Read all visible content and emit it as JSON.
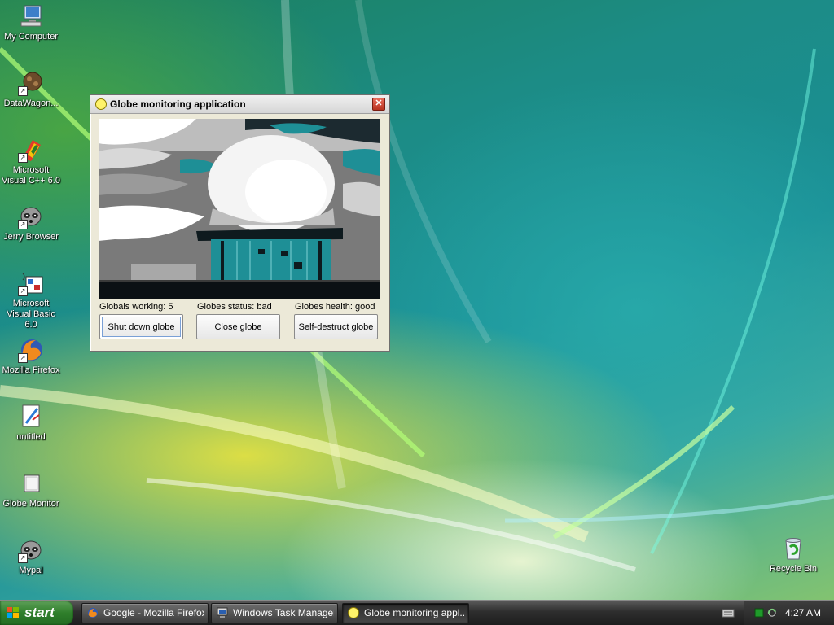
{
  "desktop": {
    "icons": [
      {
        "label": "My Computer",
        "icon": "computer-icon"
      },
      {
        "label": "DataWagon...",
        "icon": "datawagon-shortcut-icon"
      },
      {
        "label": "Microsoft Visual C++ 6.0",
        "icon": "visual-cpp-shortcut-icon"
      },
      {
        "label": "Jerry Browser",
        "icon": "raccoon-shortcut-icon"
      },
      {
        "label": "Microsoft Visual Basic 6.0",
        "icon": "visual-basic-shortcut-icon"
      },
      {
        "label": "Mozilla Firefox",
        "icon": "firefox-shortcut-icon"
      },
      {
        "label": "untitled",
        "icon": "paint-document-icon"
      },
      {
        "label": "Globe Monitor",
        "icon": "folder-icon"
      },
      {
        "label": "Mypal",
        "icon": "raccoon-shortcut-icon"
      }
    ],
    "recycle_bin": {
      "label": "Recycle Bin",
      "icon": "recycle-bin-icon"
    }
  },
  "window": {
    "title": "Globe monitoring application",
    "icon": "yellow-circle-icon",
    "close_glyph": "✕",
    "status": {
      "working": "Globals working: 5",
      "status": "Globes status:  bad",
      "health": "Globes health: good"
    },
    "buttons": {
      "shutdown": "Shut down globe",
      "close": "Close globe",
      "selfdestruct": "Self-destruct globe"
    }
  },
  "taskbar": {
    "start_label": "start",
    "tasks": [
      {
        "label": "Google - Mozilla Firefox",
        "icon": "firefox-icon"
      },
      {
        "label": "Windows Task Manager",
        "icon": "task-manager-icon"
      },
      {
        "label": "Globe monitoring appl...",
        "icon": "yellow-circle-icon"
      }
    ],
    "clock": "4:27 AM"
  },
  "colors": {
    "accent_yellow": "#fff36a",
    "close_red": "#c8402c",
    "start_green": "#2f7f2b",
    "photo_teal": "#1d9aa0"
  }
}
